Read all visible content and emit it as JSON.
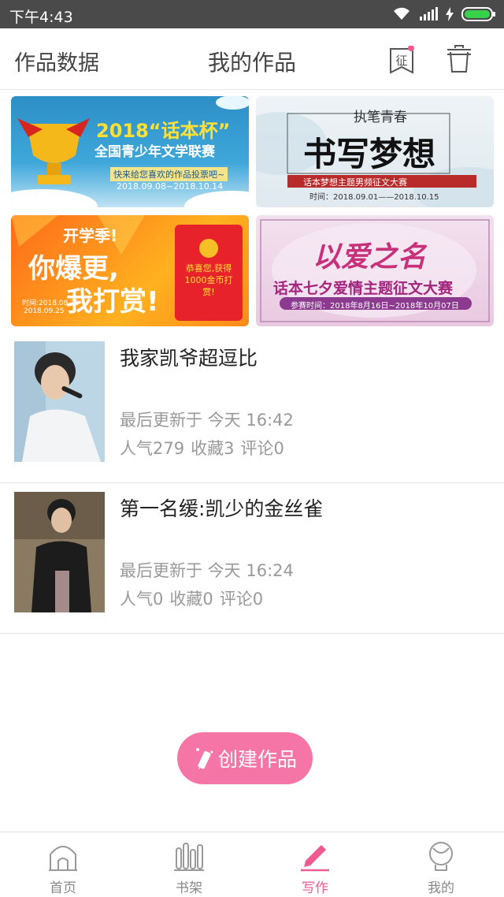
{
  "status_bar": {
    "time": "下午4:43"
  },
  "header": {
    "left_label": "作品数据",
    "title": "我的作品",
    "contest_icon_char": "征"
  },
  "banners": [
    {
      "line1": "2018“话本杯”",
      "line2": "全国青少年文学联赛",
      "line3": "快来给您喜欢的作品投票吧~",
      "dates": "2018.09.08~2018.10.14"
    },
    {
      "line1": "执笔青春",
      "line2": "书写梦想",
      "line3": "话本梦想主题男频征文大赛",
      "dates": "时间：2018.09.01——2018.10.15"
    },
    {
      "line1": "开学季!",
      "line2": "你爆更,",
      "line3": "我打赏!",
      "envelope_text": "恭喜您,获得1000金币打赏!",
      "dates_start": "时间:2018.08.25~",
      "dates_end": "2018.09.25"
    },
    {
      "line1": "以爱之名",
      "line2": "话本七夕爱情主题征文大赛",
      "dates": "参赛时间：2018年8月16日~2018年10月07日"
    }
  ],
  "works": [
    {
      "title": "我家凯爷超逗比",
      "updated": "最后更新于 今天 16:42",
      "popularity": "人气279",
      "favorites": "收藏3",
      "comments": "评论0"
    },
    {
      "title": "第一名缓:凯少的金丝雀",
      "updated": "最后更新于 今天 16:24",
      "popularity": "人气0",
      "favorites": "收藏0",
      "comments": "评论0"
    }
  ],
  "create_button": {
    "label": "创建作品"
  },
  "bottom_nav": [
    {
      "label": "首页",
      "icon": "home-icon",
      "active": false
    },
    {
      "label": "书架",
      "icon": "bookshelf-icon",
      "active": false
    },
    {
      "label": "写作",
      "icon": "pencil-icon",
      "active": true
    },
    {
      "label": "我的",
      "icon": "profile-icon",
      "active": false
    }
  ],
  "colors": {
    "accent": "#f05a93",
    "create_button": "#f576a6",
    "status_bar": "#4a4a4a"
  }
}
